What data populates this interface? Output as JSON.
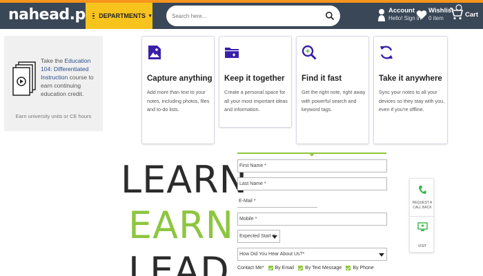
{
  "header": {
    "logo_text": "nahead.pk",
    "departments_label": "DEPARTMENTS",
    "search_placeholder": "Search here...",
    "account_title": "Account",
    "account_sub": "Hello! Sign in",
    "wishlist_title": "Wishlist",
    "wishlist_sub": "0 item",
    "cart_label": "Cart"
  },
  "promo": {
    "text_pre": "Take the ",
    "text_link": "Education 104: Differentiated Instruction",
    "text_post": " course to earn continuing education credit.",
    "hours": "Earn university units or CE hours"
  },
  "features": [
    {
      "icon": "image-icon",
      "title": "Capture anything",
      "desc": "Add more than text to your notes, including photos, files and to-do lists."
    },
    {
      "icon": "folder-icon",
      "title": "Keep it together",
      "desc": "Create a personal space for all your most important ideas and information."
    },
    {
      "icon": "search-icon",
      "title": "Find it fast",
      "desc": "Get the right note, right away with powerful search and keyword tags."
    },
    {
      "icon": "sync-icon",
      "title": "Take it anywhere",
      "desc": "Sync your notes to all your devices so they stay with you, even if you're offline."
    }
  ],
  "slogan": {
    "line1": "LEARN",
    "line2": "EARN",
    "line3": "LEAD"
  },
  "form": {
    "first_name": "First Name *",
    "last_name": "Last Name *",
    "email": "E-Mail *",
    "mobile": "Mobile *",
    "expected_start": "Expected Start Y",
    "hear_about": "How Did You Hear About Us?*",
    "contact_label": "Contact Me*",
    "by_email": "By Email",
    "by_text": "By Text Message",
    "by_phone": "By Phone"
  },
  "side_widget": {
    "callback_label": "REQUEST A CALL BACK",
    "visit_label": "VISIT"
  },
  "colors": {
    "header_bg": "#3a4757",
    "accent_orange": "#f7941d",
    "dept_yellow": "#f7c31d",
    "green": "#8dc63f",
    "icon_purple": "#3a1fa8"
  }
}
